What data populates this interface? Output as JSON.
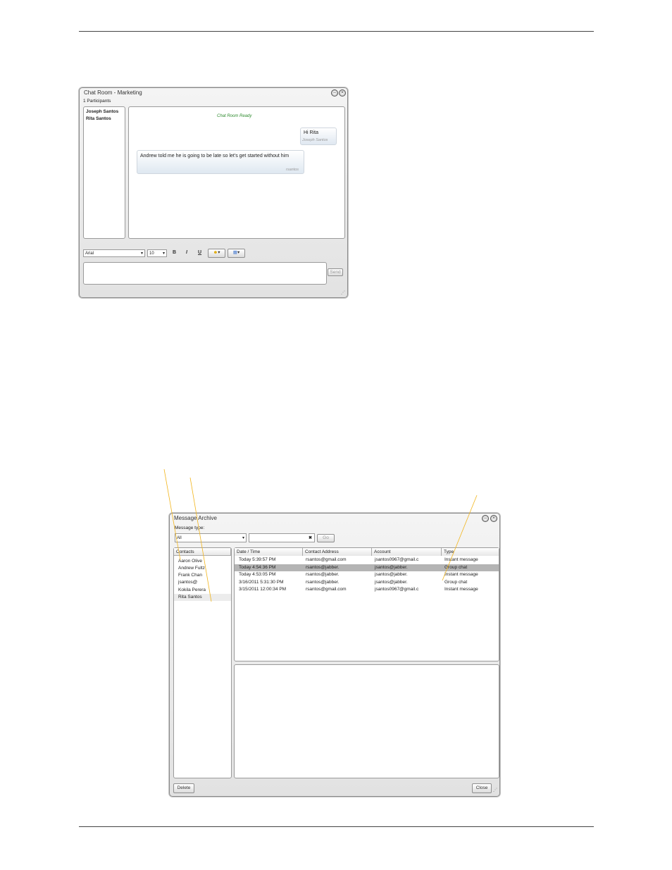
{
  "chat_window": {
    "title": "Chat Room - Marketing",
    "participants_count": "1 Participants",
    "participants": [
      "Joseph Santos",
      "Rita Santos"
    ],
    "status": "Chat Room Ready",
    "messages": [
      {
        "text": "Hi Rita",
        "sender": "Joseph Santos"
      },
      {
        "text": "Andrew told me he is going to be late so let's get started without him",
        "sender": "rsantos"
      }
    ],
    "font": "Arial",
    "font_size": "10",
    "bold_label": "B",
    "italic_label": "I",
    "underline_label": "U",
    "send_label": "Send"
  },
  "archive_window": {
    "title": "Message Archive",
    "message_type_label": "Message type:",
    "message_type_value": "All",
    "go_label": "Go",
    "contacts_header": "Contacts",
    "contacts": [
      "Aaron Olive",
      "Andrew Fultz",
      "Frank Chan",
      "jsantos@",
      "Kokila Perera",
      "Rita Santos"
    ],
    "columns": [
      "Date / Time",
      "Contact Address",
      "Account",
      "Type"
    ],
    "rows": [
      {
        "date": "Today 5:39:57 PM",
        "address": "rsantos@gmail.com",
        "account": "jsantos0967@gmail.c",
        "type": "Instant message"
      },
      {
        "date": "Today 4:54:36 PM",
        "address": "rsantos@jabber.",
        "account": "jsantos@jabber.",
        "type": "Group chat"
      },
      {
        "date": "Today 4:53:05 PM",
        "address": "rsantos@jabber.",
        "account": "jsantos@jabber.",
        "type": "Instant message"
      },
      {
        "date": "3/16/2011 5:31:30 PM",
        "address": "rsantos@jabber.",
        "account": "jsantos@jabber.",
        "type": "Group chat"
      },
      {
        "date": "3/15/2011 12:00:34 PM",
        "address": "rsantos@gmail.com",
        "account": "jsantos0967@gmail.c",
        "type": "Instant message"
      }
    ],
    "delete_label": "Delete",
    "close_label": "Close"
  },
  "colors": {
    "callout": "#f2b51d",
    "ready_text": "#2e8b2e",
    "selected_row": "#b4b4b4"
  }
}
